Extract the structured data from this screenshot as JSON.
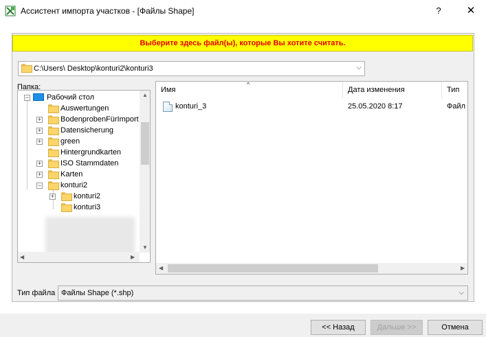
{
  "window": {
    "title": "Ассистент импорта участков - [Файлы Shape]",
    "help_label": "?",
    "close_label": "✕"
  },
  "banner": {
    "text": "Выберите здесь файл(ы), которые Вы хотите считать.",
    "color": "#e00000",
    "background": "#ffff00"
  },
  "path": {
    "value": "C:\\Users\\ Desktop\\konturi2\\konturi3"
  },
  "tree": {
    "label": "Папка:",
    "root": "Рабочий стол",
    "items": [
      {
        "label": "Auswertungen",
        "expandable": false
      },
      {
        "label": "BodenprobenFürImport",
        "expandable": true
      },
      {
        "label": "Datensicherung",
        "expandable": true
      },
      {
        "label": "green",
        "expandable": true
      },
      {
        "label": "Hintergrundkarten",
        "expandable": false
      },
      {
        "label": "ISO Stammdaten",
        "expandable": true
      },
      {
        "label": "Karten",
        "expandable": true
      },
      {
        "label": "konturi2",
        "expandable": true,
        "expanded": true
      }
    ],
    "children": [
      {
        "label": "konturi2",
        "expandable": true
      },
      {
        "label": "konturi3",
        "expandable": false
      }
    ]
  },
  "list": {
    "columns": [
      "Имя",
      "Дата изменения",
      "Тип"
    ],
    "rows": [
      {
        "name": "konturi_3",
        "date": "25.05.2020 8:17",
        "type": "Файл"
      }
    ]
  },
  "filetype": {
    "label": "Тип файла",
    "value": "Файлы Shape (*.shp)"
  },
  "buttons": {
    "back": "<< Назад",
    "next": "Дальше >>",
    "cancel": "Отмена"
  }
}
